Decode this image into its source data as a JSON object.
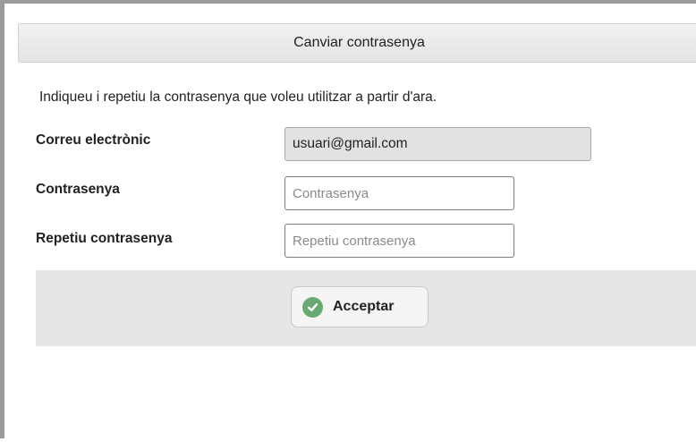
{
  "dialog": {
    "title": "Canviar contrasenya",
    "intro": "Indiqueu i repetiu la contrasenya que voleu utilitzar a partir d'ara."
  },
  "form": {
    "email_label": "Correu electrònic",
    "email_value": "usuari@gmail.com",
    "password_label": "Contrasenya",
    "password_placeholder": "Contrasenya",
    "repeat_label": "Repetiu contrasenya",
    "repeat_placeholder": "Repetiu contrasenya"
  },
  "actions": {
    "accept_label": "Acceptar",
    "accept_icon": "check-circle-icon",
    "accept_icon_color": "#6aaa72"
  }
}
